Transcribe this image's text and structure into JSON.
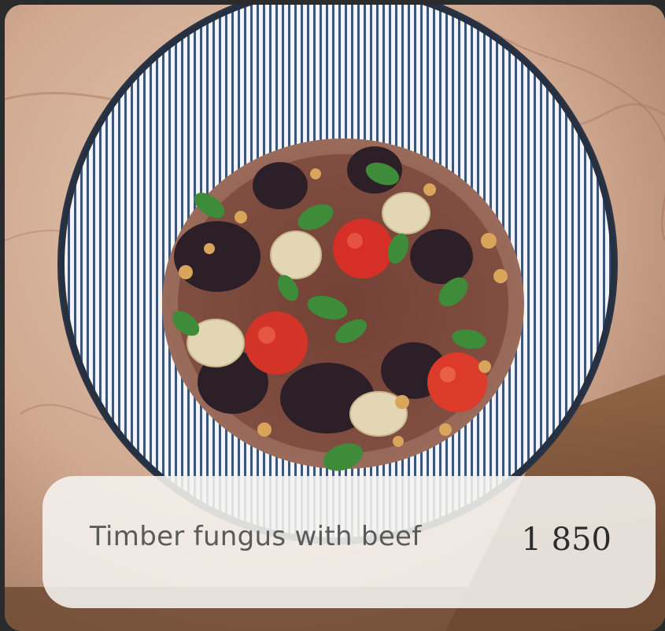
{
  "menu_item": {
    "name": "Timber fungus with beef",
    "price": "1 850"
  },
  "photo": {
    "subject": "dish-photo",
    "plate_icon": "striped-plate"
  },
  "colors": {
    "caption_bg": "#f6f4f0",
    "name_text": "#5a5a5a",
    "price_text": "#2c2c2c",
    "plate_stripe": "#3d5a80"
  }
}
